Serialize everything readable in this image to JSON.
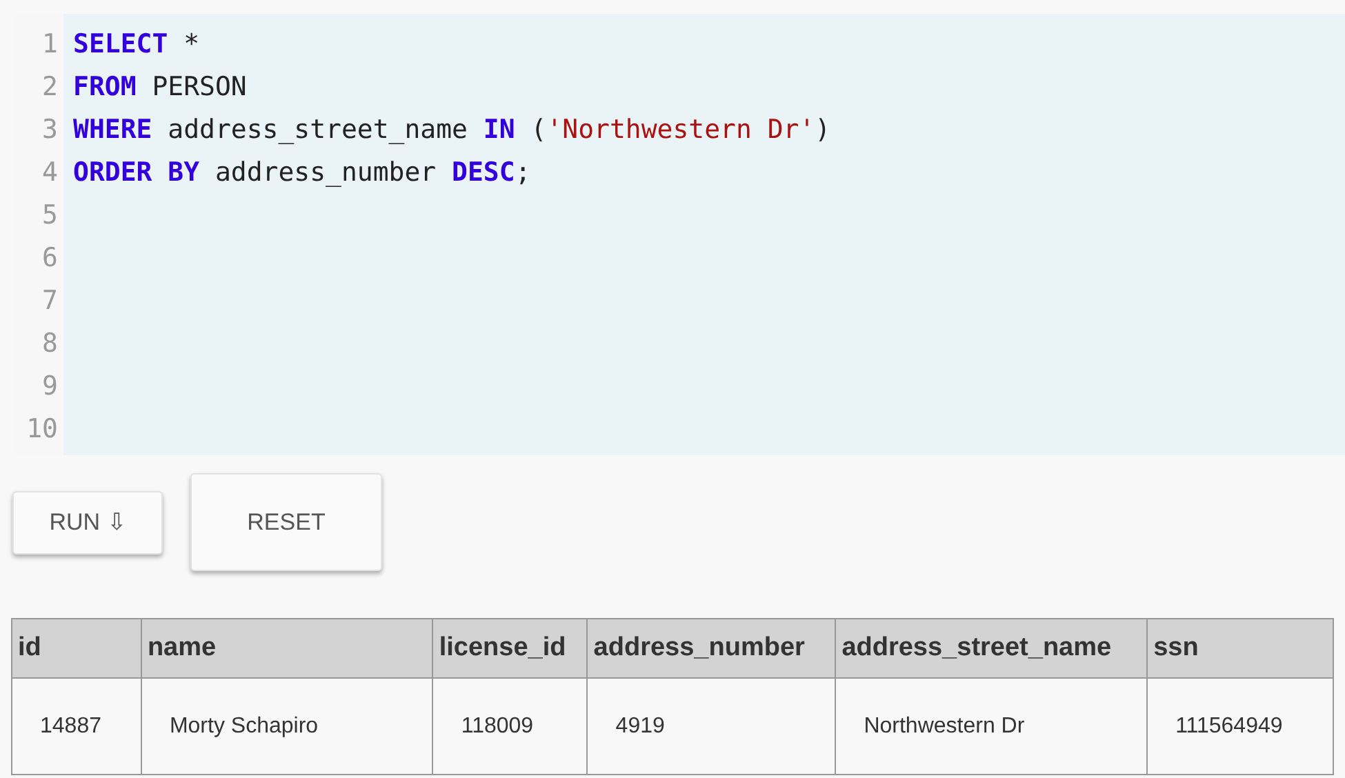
{
  "editor": {
    "lines": [
      {
        "number": "1",
        "tokens": [
          {
            "text": "SELECT",
            "kind": "keyword"
          },
          {
            "text": " *",
            "kind": "plain"
          }
        ]
      },
      {
        "number": "2",
        "tokens": [
          {
            "text": "FROM",
            "kind": "keyword"
          },
          {
            "text": " PERSON",
            "kind": "plain"
          }
        ]
      },
      {
        "number": "3",
        "tokens": [
          {
            "text": "WHERE",
            "kind": "keyword"
          },
          {
            "text": " address_street_name ",
            "kind": "plain"
          },
          {
            "text": "IN",
            "kind": "keyword"
          },
          {
            "text": " (",
            "kind": "plain"
          },
          {
            "text": "'Northwestern Dr'",
            "kind": "string"
          },
          {
            "text": ")",
            "kind": "plain"
          }
        ]
      },
      {
        "number": "4",
        "tokens": [
          {
            "text": "ORDER BY",
            "kind": "keyword"
          },
          {
            "text": " address_number ",
            "kind": "plain"
          },
          {
            "text": "DESC",
            "kind": "keyword"
          },
          {
            "text": ";",
            "kind": "plain"
          }
        ]
      },
      {
        "number": "5"
      },
      {
        "number": "6"
      },
      {
        "number": "7"
      },
      {
        "number": "8"
      },
      {
        "number": "9"
      },
      {
        "number": "10"
      }
    ]
  },
  "buttons": [
    {
      "label": "RUN ⇩",
      "kind": "run"
    },
    {
      "label": "RESET",
      "kind": "reset"
    }
  ],
  "table": {
    "columns": [
      "id",
      "name",
      "license_id",
      "address_number",
      "address_street_name",
      "ssn"
    ],
    "rows": [
      [
        "14887",
        "Morty Schapiro",
        "118009",
        "4919",
        "Northwestern Dr",
        "111564949"
      ]
    ]
  }
}
